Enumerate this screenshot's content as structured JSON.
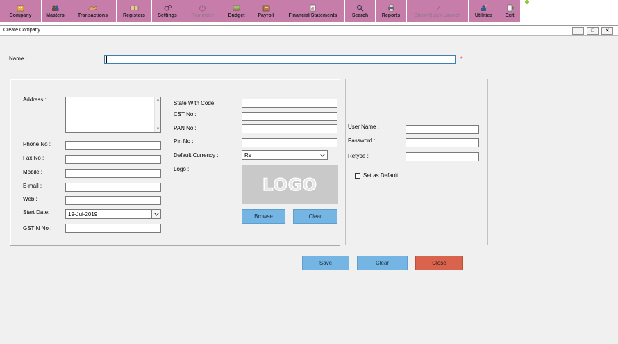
{
  "toolbar": {
    "items": [
      {
        "label": "Company",
        "icon": "building-icon",
        "enabled": true
      },
      {
        "label": "Masters",
        "icon": "users-icon",
        "enabled": true
      },
      {
        "label": "Transactions",
        "icon": "handshake-icon",
        "enabled": true
      },
      {
        "label": "Registers",
        "icon": "book-icon",
        "enabled": true
      },
      {
        "label": "Settings",
        "icon": "gears-icon",
        "enabled": true
      },
      {
        "label": "Reminder",
        "icon": "alarm-clock-icon",
        "enabled": false
      },
      {
        "label": "Budget",
        "icon": "money-hand-icon",
        "enabled": true
      },
      {
        "label": "Payroll",
        "icon": "wallet-icon",
        "enabled": true
      },
      {
        "label": "Financial Statements",
        "icon": "report-chart-icon",
        "enabled": true
      },
      {
        "label": "Search",
        "icon": "magnifier-icon",
        "enabled": true
      },
      {
        "label": "Reports",
        "icon": "printer-icon",
        "enabled": true
      },
      {
        "label": "Show Quick Launch",
        "icon": "rocket-icon",
        "enabled": false
      },
      {
        "label": "Utilities",
        "icon": "tools-user-icon",
        "enabled": true
      },
      {
        "label": "Exit",
        "icon": "exit-door-icon",
        "enabled": true
      }
    ],
    "accent": "#c77daa"
  },
  "window": {
    "title": "Create Company",
    "controls": {
      "minimize": "–",
      "restore": "□",
      "close": "✕"
    }
  },
  "form": {
    "name_label": "Name :",
    "name_value": "",
    "required_mark": "*",
    "address_label": "Address :",
    "address_value": "",
    "phone_label": "Phone No :",
    "fax_label": "Fax No :",
    "mobile_label": "Mobile :",
    "email_label": "E-mail :",
    "web_label": "Web :",
    "start_date_label": "Start Date:",
    "start_date_value": "19-Jul-2019",
    "gstin_label": "GSTIN No :",
    "state_label": "State With Code:",
    "cst_label": "CST No :",
    "pan_label": "PAN No :",
    "pin_label": "Pin No :",
    "currency_label": "Default Currency :",
    "currency_value": "Rs",
    "logo_label": "Logo :",
    "logo_text": "LOGO",
    "browse_label": "Browse",
    "logo_clear_label": "Clear",
    "username_label": "User Name :",
    "password_label": "Password :",
    "retype_label": "Retype  :",
    "set_default_label": "Set as Default",
    "set_default_checked": false
  },
  "actions": {
    "save": "Save",
    "clear": "Clear",
    "close": "Close"
  }
}
